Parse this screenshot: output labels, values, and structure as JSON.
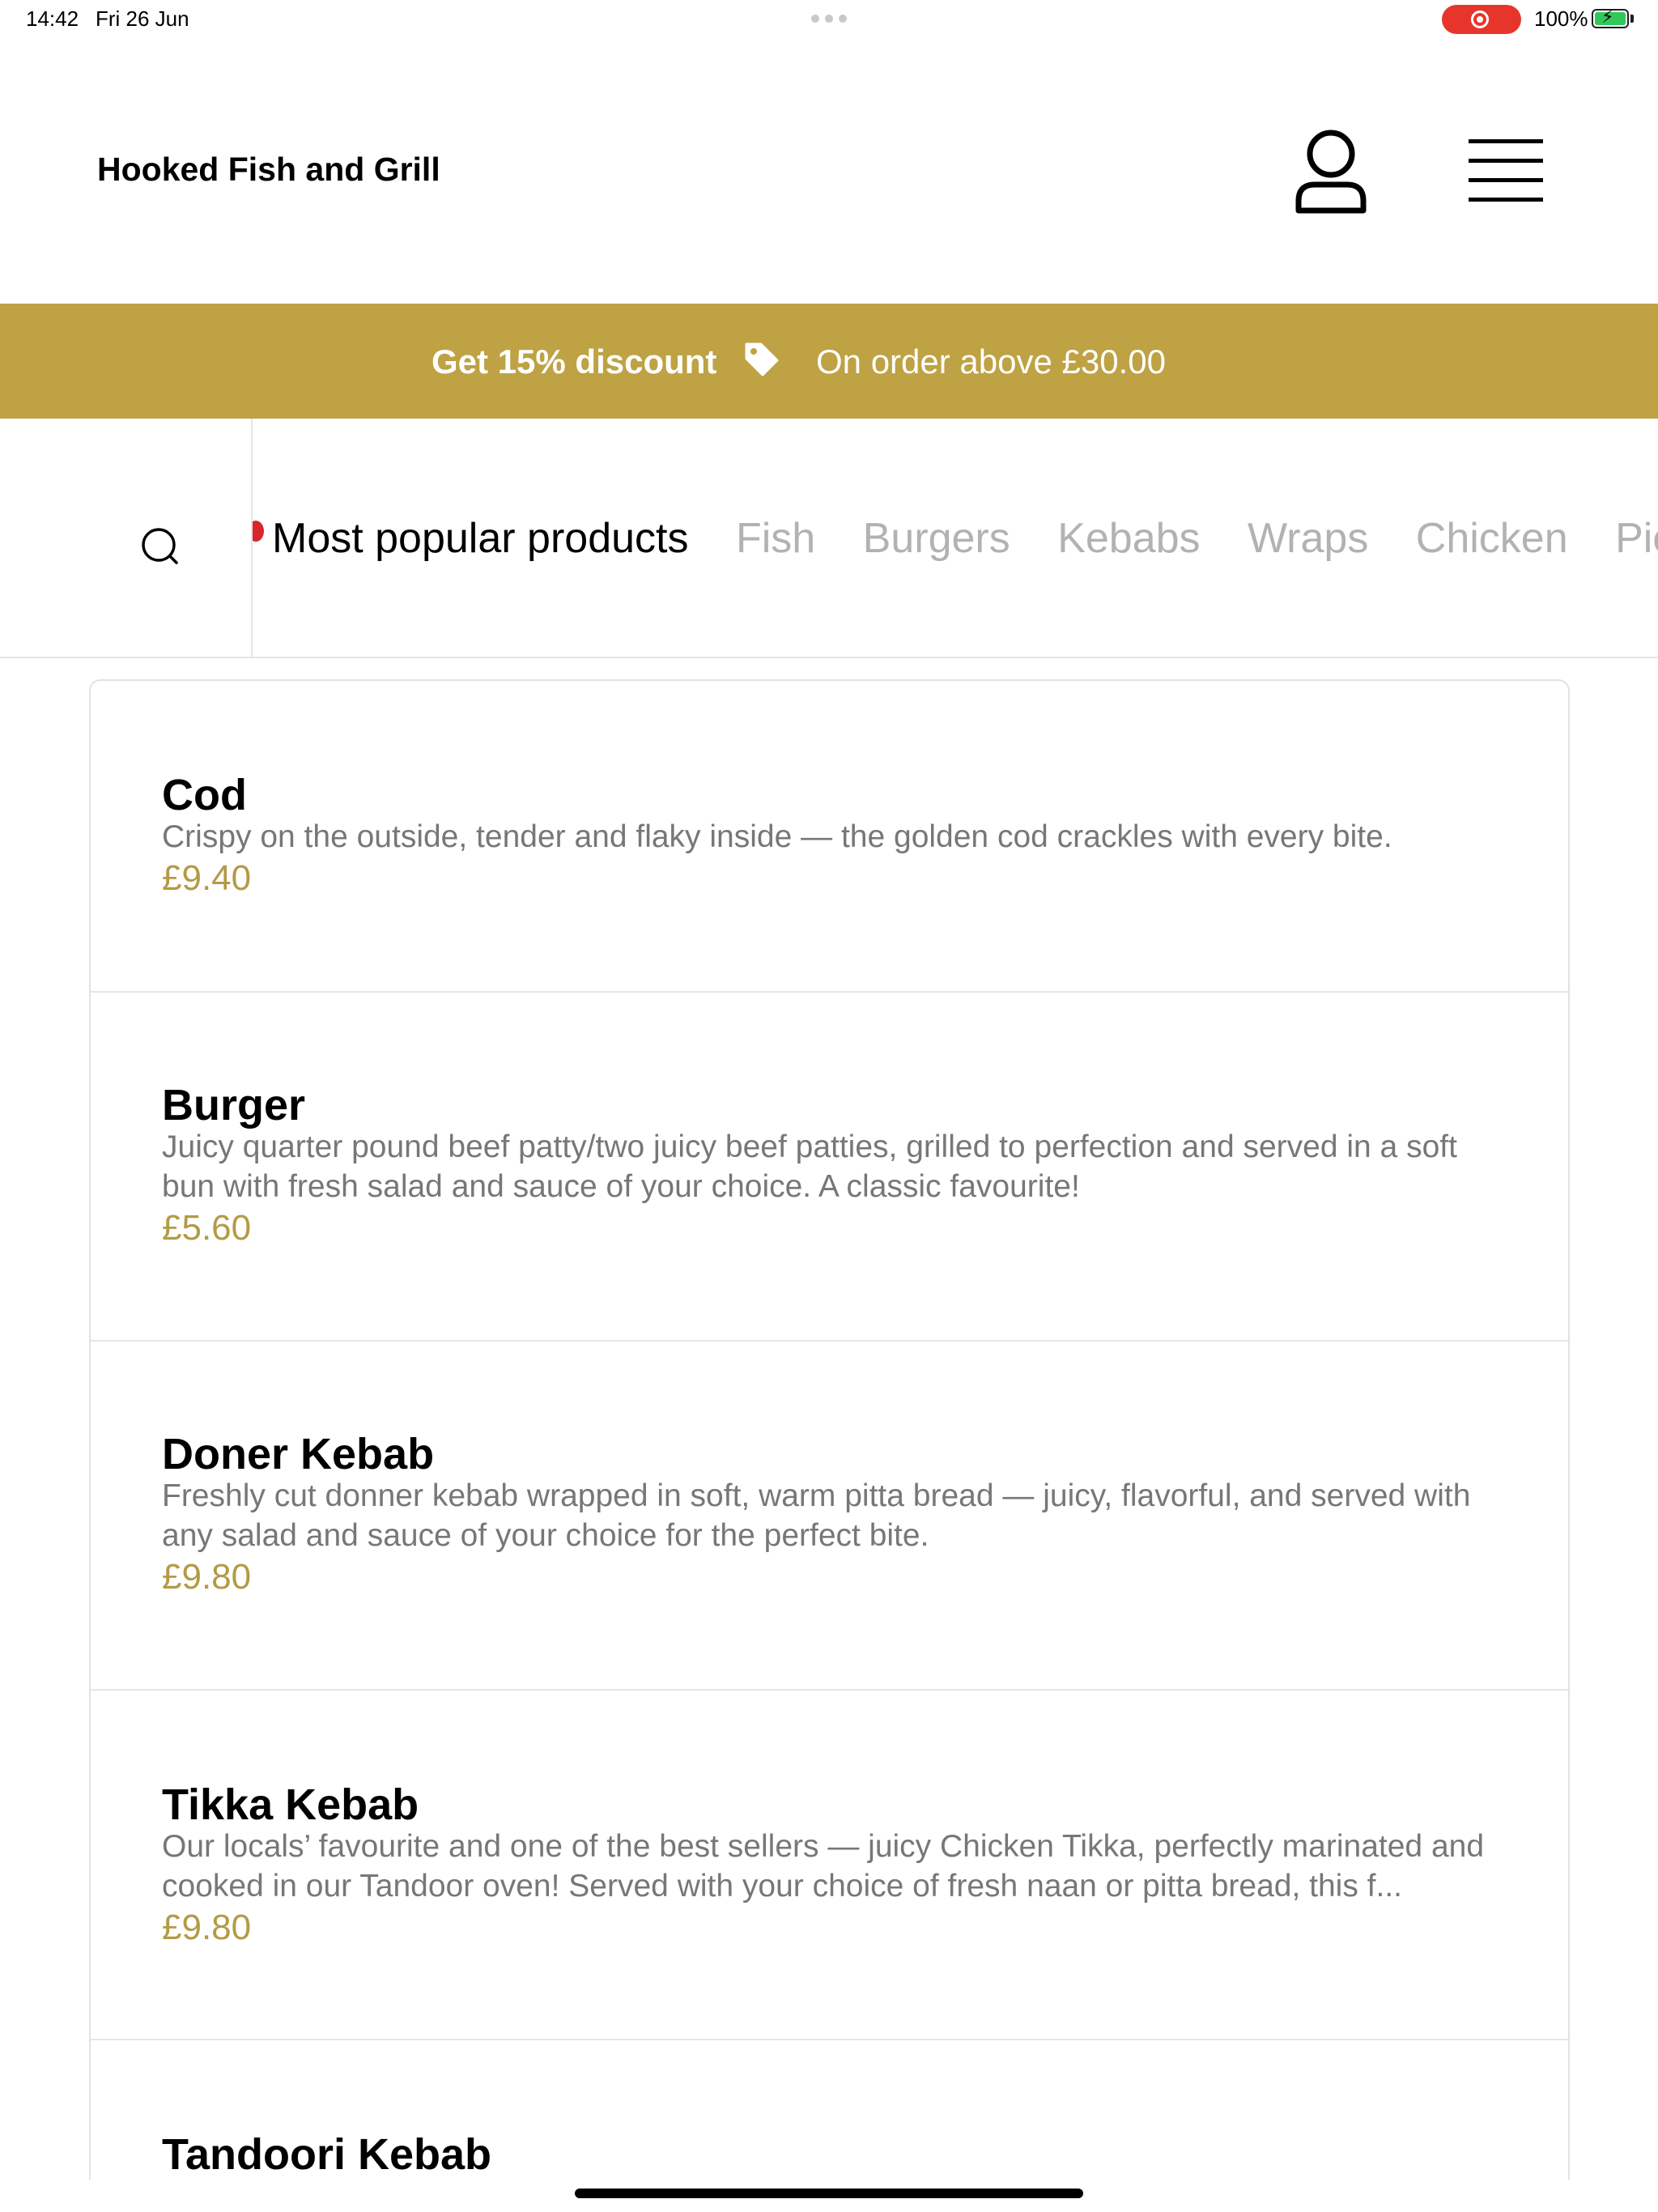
{
  "status_bar": {
    "time": "14:42",
    "date": "Fri 26 Jun",
    "battery": "100%"
  },
  "header": {
    "title": "Hooked Fish and Grill",
    "icons": {
      "account": "user-icon",
      "menu": "hamburger-menu-icon"
    }
  },
  "promo": {
    "title": "Get 15% discount",
    "subtitle": "On order above £30.00",
    "background": "#bea244"
  },
  "categories": {
    "active": "Most popular products",
    "tabs": [
      "Most popular products",
      "Fish",
      "Burgers",
      "Kebabs",
      "Wraps",
      "Chicken",
      "Pie"
    ]
  },
  "products": [
    {
      "name": "Cod",
      "description": "Crispy on the outside, tender and flaky inside — the golden cod crackles with every bite.",
      "price": "£9.40"
    },
    {
      "name": "Burger",
      "description": "Juicy quarter pound beef patty/two juicy beef patties, grilled to perfection and served in a soft bun with fresh salad and sauce of your choice. A classic favourite!",
      "price": "£5.60"
    },
    {
      "name": "Doner Kebab",
      "description": "Freshly cut donner kebab wrapped in soft, warm pitta bread — juicy, flavorful, and served with any salad and sauce of your choice for the perfect bite.",
      "price": "£9.80"
    },
    {
      "name": "Tikka Kebab",
      "description": "Our locals’ favourite and one of the best sellers — juicy Chicken Tikka, perfectly marinated and cooked in our Tandoor oven! Served with your choice of fresh naan or pitta bread, this f...",
      "price": "£9.80"
    },
    {
      "name": "Tandoori Kebab",
      "description": "",
      "price": ""
    }
  ],
  "colors": {
    "accent": "#bea244",
    "price": "#b39b45",
    "muted_text": "#777777",
    "inactive_tab": "#b2b2b2"
  }
}
